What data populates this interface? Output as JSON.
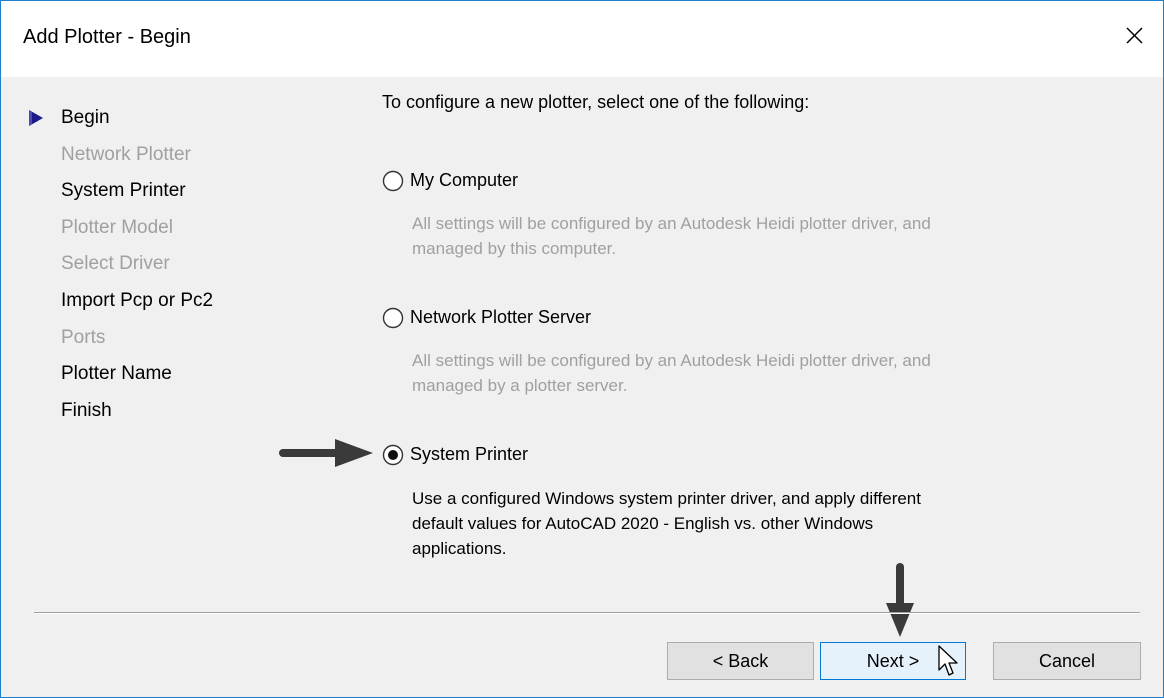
{
  "window": {
    "title": "Add Plotter - Begin",
    "close_icon": "close-icon"
  },
  "steps": [
    {
      "label": "Begin",
      "enabled": true,
      "current": true
    },
    {
      "label": "Network Plotter",
      "enabled": false
    },
    {
      "label": "System Printer",
      "enabled": true
    },
    {
      "label": "Plotter Model",
      "enabled": false
    },
    {
      "label": "Select Driver",
      "enabled": false
    },
    {
      "label": "Import Pcp or Pc2",
      "enabled": true
    },
    {
      "label": "Ports",
      "enabled": false
    },
    {
      "label": "Plotter Name",
      "enabled": true
    },
    {
      "label": "Finish",
      "enabled": true
    }
  ],
  "main": {
    "intro": "To configure a new plotter, select one of the following:",
    "options": [
      {
        "label": "My Computer",
        "description": "All settings will be configured by an Autodesk Heidi plotter driver, and managed by this computer.",
        "selected": false
      },
      {
        "label": "Network Plotter Server",
        "description": "All settings will be configured by an Autodesk Heidi plotter driver, and managed by a plotter server.",
        "selected": false
      },
      {
        "label": "System Printer",
        "description": "Use a configured Windows system printer driver, and apply different default values for AutoCAD 2020 - English vs. other Windows applications.",
        "selected": true
      }
    ]
  },
  "buttons": {
    "back": "< Back",
    "next": "Next >",
    "cancel": "Cancel"
  },
  "colors": {
    "accent": "#0078d7",
    "disabled_text": "#a0a0a0",
    "window_border": "#1e7fce",
    "dialog_bg": "#f0f0f0"
  }
}
